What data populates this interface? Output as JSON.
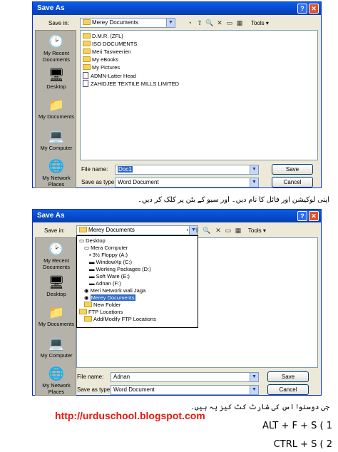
{
  "dialog1": {
    "title": "Save As",
    "save_in_label": "Save in:",
    "save_in_value": "Merey Documents",
    "tools_label": "Tools",
    "places": [
      "My Recent Documents",
      "Desktop",
      "My Documents",
      "My Computer",
      "My Network Places"
    ],
    "files": [
      "D.M.R. (ZFL)",
      "ISO DOCUMENTS",
      "Meri Tasweerien",
      "My eBooks",
      "My Pictures",
      "ADMN-Latter Head",
      "ZAHIDJEE TEXTILE MILLS LIMITED"
    ],
    "file_name_label": "File name:",
    "file_name_value": "Doc1",
    "save_as_type_label": "Save as type:",
    "save_as_type_value": "Word Document",
    "save_button": "Save",
    "cancel_button": "Cancel"
  },
  "caption1": "اپنی لوکیشن اور فائل کا نام دیں۔ اور سیو کے بٹن پر کلک کر دیں۔",
  "dialog2": {
    "title": "Save As",
    "save_in_label": "Save in:",
    "save_in_value": "Merey Documents",
    "tools_label": "Tools",
    "places": [
      "My Recent Documents",
      "Desktop",
      "My Documents",
      "My Computer",
      "My Network Places"
    ],
    "dropdown_items": [
      "Desktop",
      "Mera Computer",
      "3½ Floppy (A:)",
      "WindowXp (C:)",
      "Working Packages (D:)",
      "Soft Ware (E:)",
      "Adnan (F:)",
      "Meri Network wali Jaga",
      "Merey Documents",
      "New Folder",
      "FTP Locations",
      "Add/Modify FTP Locations"
    ],
    "file_name_label": "File name:",
    "file_name_value": "Adnan",
    "save_as_type_label": "Save as type:",
    "save_as_type_value": "Word Document",
    "save_button": "Save",
    "cancel_button": "Cancel"
  },
  "url": "http://urduschool.blogspot.com",
  "caption2": "جی دوستو! اس کی شارٹ کٹ کیز یہ ہیں۔",
  "shortcuts": [
    "ALT + F + S   ( 1",
    "CTRL + S   ( 2"
  ],
  "colors": {
    "title_bar": "#0747c8",
    "url": "#e8170f",
    "dialog_bg": "#ece9d8"
  }
}
